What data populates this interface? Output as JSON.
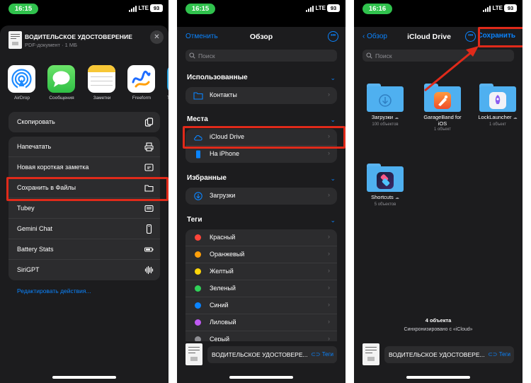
{
  "status_bar": {
    "panel1_time": "16:15",
    "panel2_time": "16:15",
    "panel3_time": "16:16",
    "network": "LTE",
    "battery": "93"
  },
  "share_sheet": {
    "doc_title": "ВОДИТЕЛЬСКОЕ УДОСТОВЕРЕНИЕ",
    "doc_subtitle": "PDF-документ · 1 МБ",
    "close_icon": "✕",
    "apps": [
      {
        "label": "AirDrop",
        "icon": "airdrop-icon"
      },
      {
        "label": "Сообщения",
        "icon": "messages-icon"
      },
      {
        "label": "Заметки",
        "icon": "notes-icon"
      },
      {
        "label": "Freeform",
        "icon": "freeform-icon"
      },
      {
        "label": "Te",
        "icon": "telegram-icon"
      }
    ],
    "copy_action": {
      "label": "Скопировать",
      "icon": "copy-icon"
    },
    "actions": [
      {
        "label": "Напечатать",
        "icon": "printer-icon"
      },
      {
        "label": "Новая короткая заметка",
        "icon": "quick-note-icon"
      },
      {
        "label": "Сохранить в Файлы",
        "icon": "folder-icon"
      },
      {
        "label": "Tubey",
        "icon": "tubey-icon"
      },
      {
        "label": "Gemini Chat",
        "icon": "phone-icon"
      },
      {
        "label": "Battery Stats",
        "icon": "battery-icon"
      },
      {
        "label": "SiriGPT",
        "icon": "waveform-icon"
      }
    ],
    "edit_actions": "Редактировать действия..."
  },
  "browse": {
    "cancel": "Отменить",
    "title": "Обзор",
    "search_placeholder": "Поиск",
    "recents_header": "Использованные",
    "recents": [
      {
        "label": "Контакты",
        "icon": "folder-icon"
      }
    ],
    "places_header": "Места",
    "places": [
      {
        "label": "iCloud Drive",
        "icon": "icloud-icon"
      },
      {
        "label": "На iPhone",
        "icon": "iphone-icon"
      }
    ],
    "favorites_header": "Избранные",
    "favorites": [
      {
        "label": "Загрузки",
        "icon": "download-icon"
      }
    ],
    "tags_header": "Теги",
    "tags": [
      {
        "label": "Красный",
        "color": "#ff453a"
      },
      {
        "label": "Оранжевый",
        "color": "#ff9f0a"
      },
      {
        "label": "Желтый",
        "color": "#ffd60a"
      },
      {
        "label": "Зеленый",
        "color": "#30d158"
      },
      {
        "label": "Синий",
        "color": "#0a84ff"
      },
      {
        "label": "Лиловый",
        "color": "#bf5af2"
      },
      {
        "label": "Серый",
        "color": "#8e8e93"
      }
    ],
    "bottom_file_name": "ВОДИТЕЛЬСКОЕ УДОСТОВЕРЕ...",
    "bottom_tags": "Теги"
  },
  "icloud": {
    "back": "Обзор",
    "title": "iCloud Drive",
    "save": "Сохранить",
    "search_placeholder": "Поиск",
    "folders": [
      {
        "name": "Загрузки",
        "count": "100 объектов",
        "icon": "download-icon"
      },
      {
        "name": "GarageBand for iOS",
        "count": "1 объект",
        "icon": "garageband-icon"
      },
      {
        "name": "LockLauncher",
        "count": "1 объект",
        "icon": "locklauncher-icon"
      },
      {
        "name": "Shortcuts",
        "count": "5 объектов",
        "icon": "shortcuts-icon"
      }
    ],
    "items_count": "4 объекта",
    "sync_status": "Синхронизировано с «iCloud»",
    "bottom_file_name": "ВОДИТЕЛЬСКОЕ УДОСТОВЕРЕ...",
    "bottom_tags": "Теги"
  },
  "colors": {
    "accent": "#0a84ff",
    "highlight": "#e02a1a",
    "status_green": "#30c24d"
  }
}
